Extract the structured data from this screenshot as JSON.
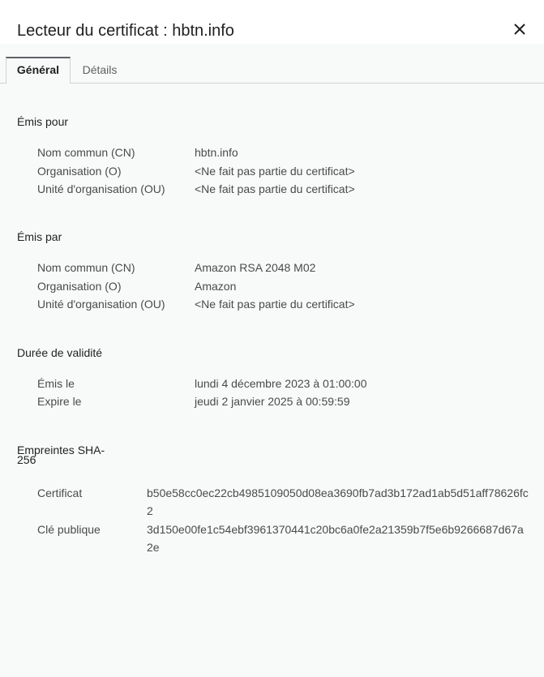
{
  "dialog": {
    "title": "Lecteur du certificat : hbtn.info",
    "close_icon": "close-icon"
  },
  "tabs": [
    {
      "label": "Général",
      "selected": true
    },
    {
      "label": "Détails",
      "selected": false
    }
  ],
  "issued_to": {
    "title": "Émis pour",
    "rows": [
      {
        "label": "Nom commun (CN)",
        "value": "hbtn.info"
      },
      {
        "label": "Organisation (O)",
        "value": "<Ne fait pas partie du certificat>"
      },
      {
        "label": "Unité d'organisation (OU)",
        "value": "<Ne fait pas partie du certificat>"
      }
    ]
  },
  "issued_by": {
    "title": "Émis par",
    "rows": [
      {
        "label": "Nom commun (CN)",
        "value": "Amazon RSA 2048 M02"
      },
      {
        "label": "Organisation (O)",
        "value": "Amazon"
      },
      {
        "label": "Unité d'organisation (OU)",
        "value": "<Ne fait pas partie du certificat>"
      }
    ]
  },
  "validity": {
    "title": "Durée de validité",
    "rows": [
      {
        "label": "Émis le",
        "value": "lundi 4 décembre 2023 à 01:00:00"
      },
      {
        "label": "Expire le",
        "value": "jeudi 2 janvier 2025 à 00:59:59"
      }
    ]
  },
  "fingerprints": {
    "title": "Empreintes SHA-256",
    "rows": [
      {
        "label": "Certificat",
        "value": "b50e58cc0ec22cb4985109050d08ea3690fb7ad3b172ad1ab5d51aff78626fc2"
      },
      {
        "label": "Clé publique",
        "value": "3d150e00fe1c54ebf3961370441c20bc6a0fe2a21359b7f5e6b9266687d67a2e"
      }
    ]
  }
}
